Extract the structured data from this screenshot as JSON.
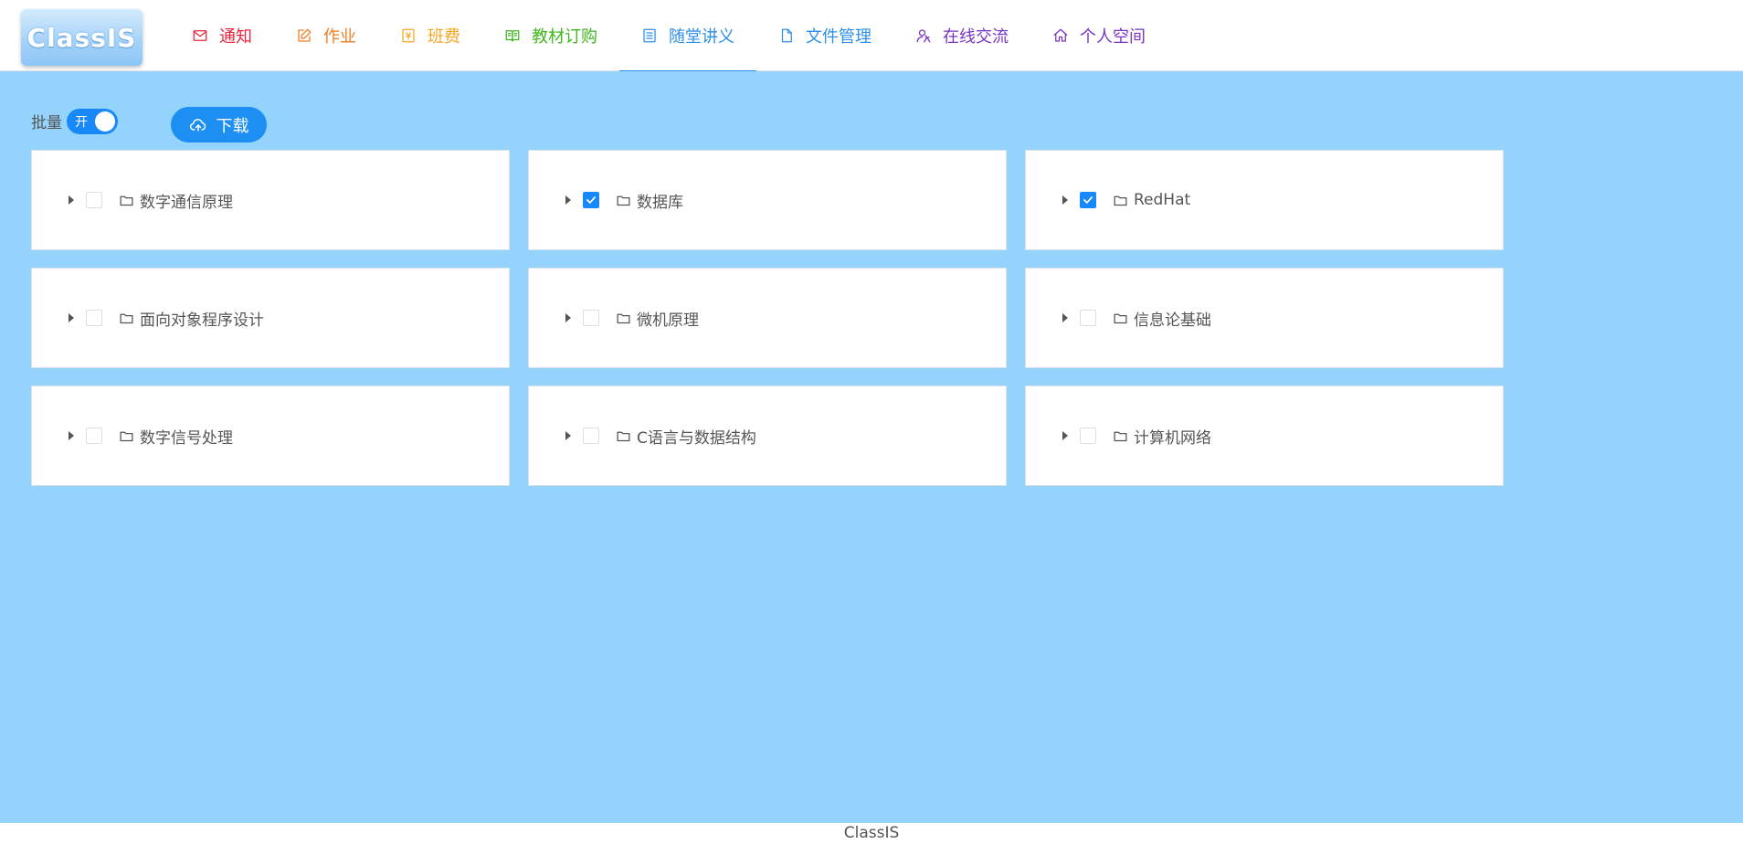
{
  "header": {
    "logo_text": "ClassIS",
    "nav": [
      {
        "label": "通知",
        "icon": "mail-icon",
        "color": "#e8243d",
        "active": false
      },
      {
        "label": "作业",
        "icon": "edit-icon",
        "color": "#f07e24",
        "active": false
      },
      {
        "label": "班费",
        "icon": "money-icon",
        "color": "#f6a523",
        "active": false
      },
      {
        "label": "教材订购",
        "icon": "book-icon",
        "color": "#3fb71d",
        "active": false
      },
      {
        "label": "随堂讲义",
        "icon": "notes-icon",
        "color": "#2f8fe8",
        "active": true
      },
      {
        "label": "文件管理",
        "icon": "document-icon",
        "color": "#2f8fe8",
        "active": false
      },
      {
        "label": "在线交流",
        "icon": "users-icon",
        "color": "#7a34c4",
        "active": false
      },
      {
        "label": "个人空间",
        "icon": "home-icon",
        "color": "#7a34c4",
        "active": false
      }
    ]
  },
  "toolbar": {
    "batch_label": "批量",
    "switch_text": "开",
    "switch_on": true,
    "download_label": "下载"
  },
  "folders": [
    {
      "name": "数字通信原理",
      "checked": false
    },
    {
      "name": "数据库",
      "checked": true
    },
    {
      "name": "RedHat",
      "checked": true
    },
    {
      "name": "面向对象程序设计",
      "checked": false
    },
    {
      "name": "微机原理",
      "checked": false
    },
    {
      "name": "信息论基础",
      "checked": false
    },
    {
      "name": "数字信号处理",
      "checked": false
    },
    {
      "name": "C语言与数据结构",
      "checked": false
    },
    {
      "name": "计算机网络",
      "checked": false
    }
  ],
  "footer": {
    "text": "ClassIS"
  },
  "colors": {
    "background": "#94d3fc",
    "accent": "#1989fa"
  }
}
